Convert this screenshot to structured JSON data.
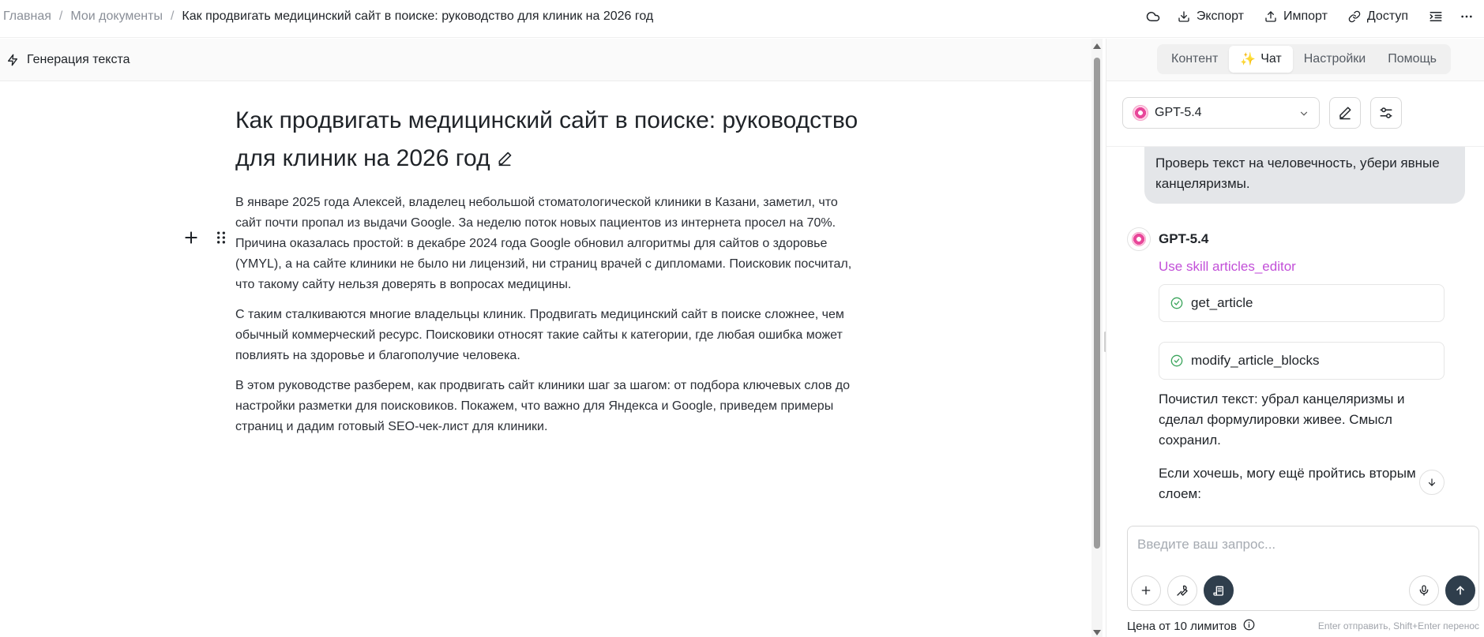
{
  "breadcrumb": {
    "home": "Главная",
    "docs": "Мои документы",
    "current": "Как продвигать медицинский сайт в поиске: руководство для клиник на 2026 год"
  },
  "toolbar": {
    "cloud_icon": "cloud-icon",
    "export_label": "Экспорт",
    "import_label": "Импорт",
    "access_label": "Доступ",
    "outline_icon": "list-indent-icon",
    "more_icon": "more-horizontal-icon"
  },
  "editor": {
    "gen_label": "Генерация текста",
    "title": "Как продвигать медицинский сайт в поиске: руководство для клиник на 2026 год",
    "paragraphs": [
      "В январе 2025 года Алексей, владелец небольшой стоматологической клиники в Казани, заметил, что сайт почти пропал из выдачи Google. За неделю поток новых пациентов из интернета просел на 70%. Причина оказалась простой: в декабре 2024 года Google обновил алгоритмы для сайтов о здоровье (YMYL), а на сайте клиники не было ни лицензий, ни страниц врачей с дипломами. Поисковик посчитал, что такому сайту нельзя доверять в вопросах медицины.",
      "С таким сталкиваются многие владельцы клиник. Продвигать медицинский сайт в поиске сложнее, чем обычный коммерческий ресурс. Поисковики относят такие сайты к категории, где любая ошибка может повлиять на здоровье и благополучие человека.",
      "В этом руководстве разберем, как продвигать сайт клиники шаг за шагом: от подбора ключевых слов до настройки разметки для поисковиков. Покажем, что важно для Яндекса и Google, приведем примеры страниц и дадим готовый SEO-чек-лист для клиники."
    ]
  },
  "panel": {
    "tabs": {
      "content": "Контент",
      "chat": "Чат",
      "settings": "Настройки",
      "help": "Помощь"
    },
    "chat_tab_icon": "✨",
    "model": "GPT-5.4",
    "user_message": "Проверь текст на человечность, убери явные канцеляризмы.",
    "assistant": {
      "name": "GPT-5.4",
      "skill": "Use skill articles_editor",
      "tools": [
        "get_article",
        "modify_article_blocks"
      ],
      "texts": [
        "Почистил текст: убрал канцеляризмы и сделал формулировки живее. Смысл сохранил.",
        "Если хочешь, могу ещё пройтись вторым слоем:"
      ]
    },
    "composer": {
      "placeholder": "Введите ваш запрос..."
    },
    "footer": {
      "price": "Цена от 10 лимитов",
      "hint": "Enter отправить, Shift+Enter перенос"
    }
  },
  "colors": {
    "skill": "#c24fd8",
    "send_button": "#2f3e4c",
    "check": "#3ba55c"
  }
}
